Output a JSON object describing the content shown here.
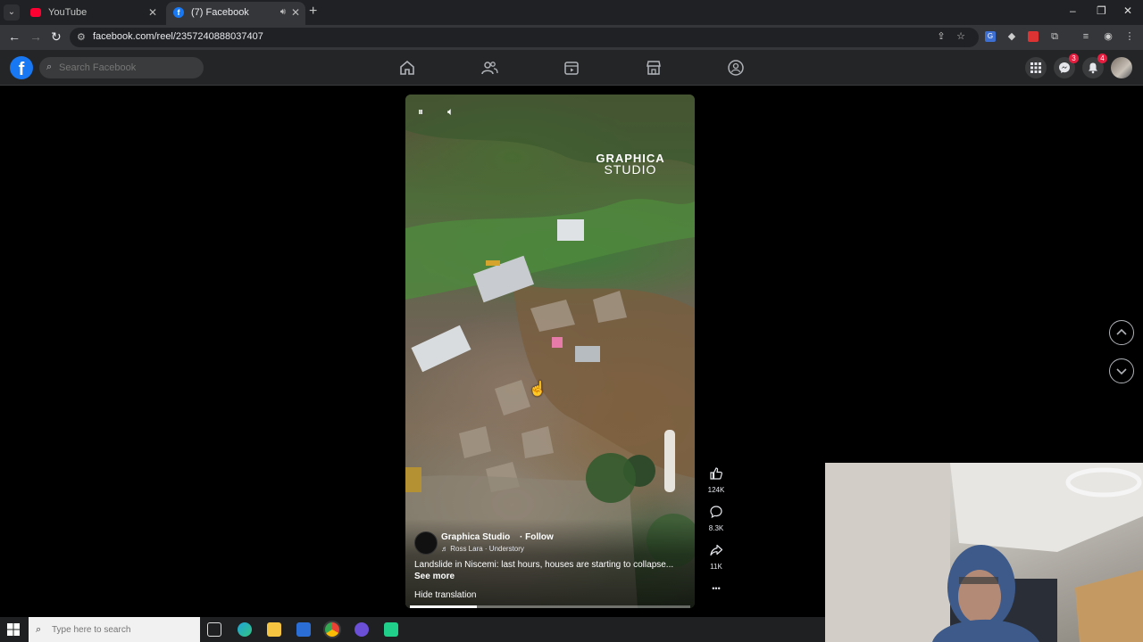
{
  "browser": {
    "tabs": [
      {
        "title": "YouTube",
        "favicon": "youtube-icon",
        "active": false
      },
      {
        "title": "(7) Facebook",
        "favicon": "facebook-icon",
        "active": true
      }
    ],
    "new_tab_label": "+",
    "url": "facebook.com/reel/2357240888037407",
    "window_controls": {
      "minimize": "–",
      "restore": "❐",
      "close": "✕"
    }
  },
  "facebook": {
    "logo": "f",
    "search": {
      "placeholder": "Search Facebook"
    },
    "nav_icons": [
      "home-icon",
      "friends-icon",
      "video-icon",
      "marketplace-icon",
      "groups-icon"
    ],
    "badges": {
      "messenger": "3",
      "notifications": "4"
    },
    "accent": "#1877f2"
  },
  "reel": {
    "watermark_line1": "GRAPHICA",
    "watermark_line2": "STUDIO",
    "page_name": "Graphica Studio",
    "follow_label": "· Follow",
    "music": "♬ Ross Lara · Understory",
    "caption": "Landslide in Niscemi: last hours, houses are starting to collapse...",
    "see_more": "See more",
    "hide_translation": "Hide translation",
    "progress": 0.24
  },
  "actions": {
    "likes": "124K",
    "comments": "8.3K",
    "shares": "11K",
    "more": "•••"
  },
  "taskbar": {
    "search_placeholder": "Type here to search"
  }
}
